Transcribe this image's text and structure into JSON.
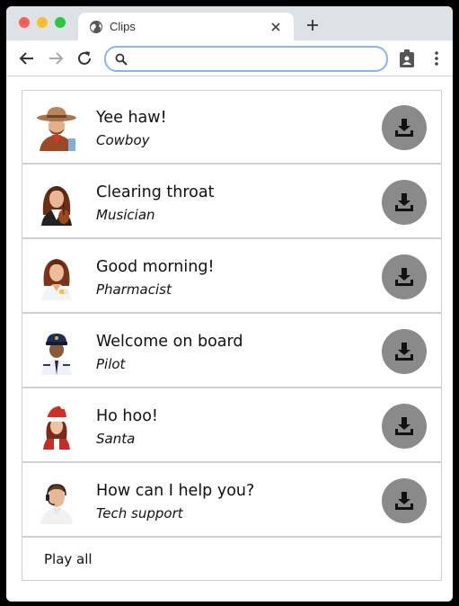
{
  "browser": {
    "tab_title": "Clips",
    "new_tab_label": "+",
    "address": {
      "value": "",
      "placeholder": ""
    }
  },
  "clips": [
    {
      "message": "Yee haw!",
      "role": "Cowboy",
      "avatar": "cowboy-avatar"
    },
    {
      "message": "Clearing throat",
      "role": "Musician",
      "avatar": "musician-avatar"
    },
    {
      "message": "Good morning!",
      "role": "Pharmacist",
      "avatar": "pharmacist-avatar"
    },
    {
      "message": "Welcome on board",
      "role": "Pilot",
      "avatar": "pilot-avatar"
    },
    {
      "message": "Ho hoo!",
      "role": "Santa",
      "avatar": "santa-avatar"
    },
    {
      "message": "How can I help you?",
      "role": "Tech support",
      "avatar": "tech-support-avatar"
    }
  ],
  "play_all_label": "Play all",
  "colors": {
    "download_button": "#8a8a8a",
    "divider": "#cfcfcf",
    "omnibox_focus": "#8ab4f8",
    "tabstrip": "#dee1e6"
  }
}
